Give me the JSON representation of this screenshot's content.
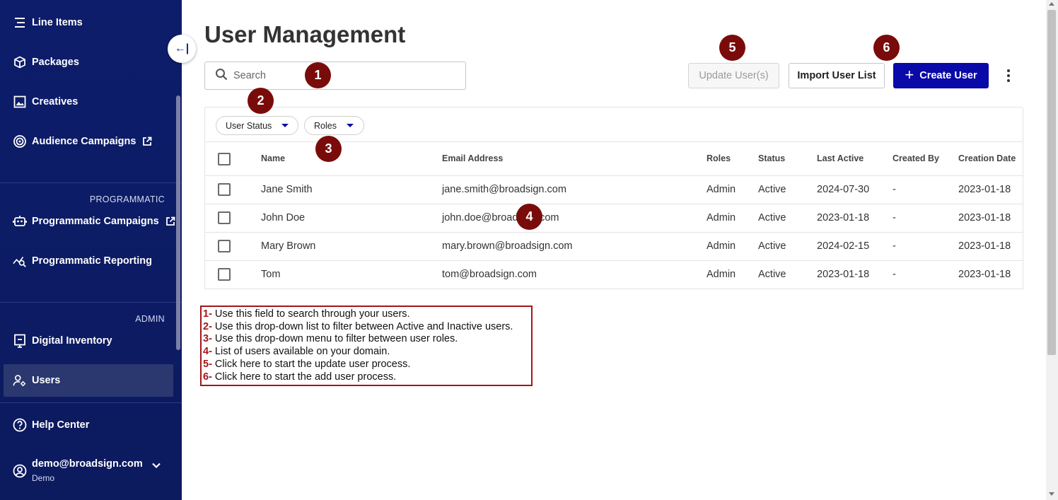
{
  "sidebar": {
    "items": [
      {
        "label": "Line Items",
        "icon": "list-icon"
      },
      {
        "label": "Packages",
        "icon": "package-icon"
      },
      {
        "label": "Creatives",
        "icon": "image-icon"
      },
      {
        "label": "Audience Campaigns",
        "icon": "audience-icon",
        "external": true
      },
      {
        "label": "Programmatic Campaigns",
        "icon": "robot-icon",
        "external": true
      },
      {
        "label": "Programmatic Reporting",
        "icon": "chart-search-icon"
      },
      {
        "label": "Digital Inventory",
        "icon": "screen-icon"
      },
      {
        "label": "Users",
        "icon": "users-gear-icon",
        "active": true
      },
      {
        "label": "Help Center",
        "icon": "help-icon"
      }
    ],
    "sections": {
      "programmatic": "PROGRAMMATIC",
      "admin": "ADMIN"
    },
    "user": {
      "email": "demo@broadsign.com",
      "name": "Demo"
    },
    "collapse_glyph": "←|"
  },
  "page": {
    "title": "User Management"
  },
  "search": {
    "placeholder": "Search",
    "value": ""
  },
  "toolbar": {
    "update_label": "Update User(s)",
    "import_label": "Import User List",
    "create_label": "Create User",
    "create_plus": "+"
  },
  "filters": {
    "status_label": "User Status",
    "roles_label": "Roles"
  },
  "table": {
    "headers": [
      "Name",
      "Email Address",
      "Roles",
      "Status",
      "Last Active",
      "Created By",
      "Creation Date"
    ],
    "rows": [
      [
        "Jane Smith",
        "jane.smith@broadsign.com",
        "Admin",
        "Active",
        "2024-07-30",
        "-",
        "2023-01-18"
      ],
      [
        "John Doe",
        "john.doe@broadsign.com",
        "Admin",
        "Active",
        "2023-01-18",
        "-",
        "2023-01-18"
      ],
      [
        "Mary Brown",
        "mary.brown@broadsign.com",
        "Admin",
        "Active",
        "2024-02-15",
        "-",
        "2023-01-18"
      ],
      [
        "Tom",
        "tom@broadsign.com",
        "Admin",
        "Active",
        "2023-01-18",
        "-",
        "2023-01-18"
      ]
    ]
  },
  "markers": [
    "1",
    "2",
    "3",
    "4",
    "5",
    "6"
  ],
  "legend": [
    {
      "num": "1-",
      "text": " Use this field to search through your users."
    },
    {
      "num": "2-",
      "text": " Use this drop-down list to filter between Active and Inactive users."
    },
    {
      "num": "3-",
      "text": " Use this drop-down menu to filter between user roles."
    },
    {
      "num": "4-",
      "text": " List of users available on your domain."
    },
    {
      "num": "5-",
      "text": " Click here to start the update user process."
    },
    {
      "num": "6-",
      "text": " Click here to start the add user process."
    }
  ],
  "colors": {
    "sidebar_bg": "#0c1a5e",
    "primary": "#0a0aa8",
    "marker": "#7a0b0b",
    "legend_border": "#a4161a"
  }
}
